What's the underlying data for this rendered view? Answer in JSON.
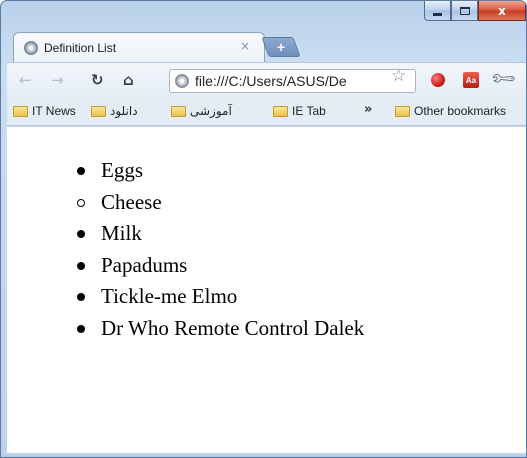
{
  "window": {
    "minimize_label": "",
    "maximize_label": "",
    "close_label": "x"
  },
  "tab": {
    "title": "Definition List",
    "close_label": "×",
    "new_tab_label": "+"
  },
  "toolbar": {
    "back_icon": "back-arrow-icon",
    "forward_icon": "forward-arrow-icon",
    "reload_icon": "reload-icon",
    "home_icon": "home-icon",
    "url": "file:///C:/Users/ASUS/De",
    "bookmark_star_icon": "star-icon",
    "ext_aa_label": "Aa",
    "wrench_icon": "wrench-icon"
  },
  "bookmarks": {
    "items": [
      "IT News",
      "دانلود",
      "آموزشی",
      "IE Tab"
    ],
    "overflow_label": "»",
    "other_label": "Other bookmarks"
  },
  "list": {
    "items": [
      {
        "text": "Eggs",
        "bullet": "disc"
      },
      {
        "text": "Cheese",
        "bullet": "circle"
      },
      {
        "text": "Milk",
        "bullet": "disc"
      },
      {
        "text": "Papadums",
        "bullet": "disc"
      },
      {
        "text": "Tickle-me Elmo",
        "bullet": "disc"
      },
      {
        "text": "Dr Who Remote Control Dalek",
        "bullet": "disc"
      }
    ]
  },
  "colors": {
    "frame": "#c9ddf2",
    "close_button": "#d9553c",
    "folder": "#eec04c"
  }
}
